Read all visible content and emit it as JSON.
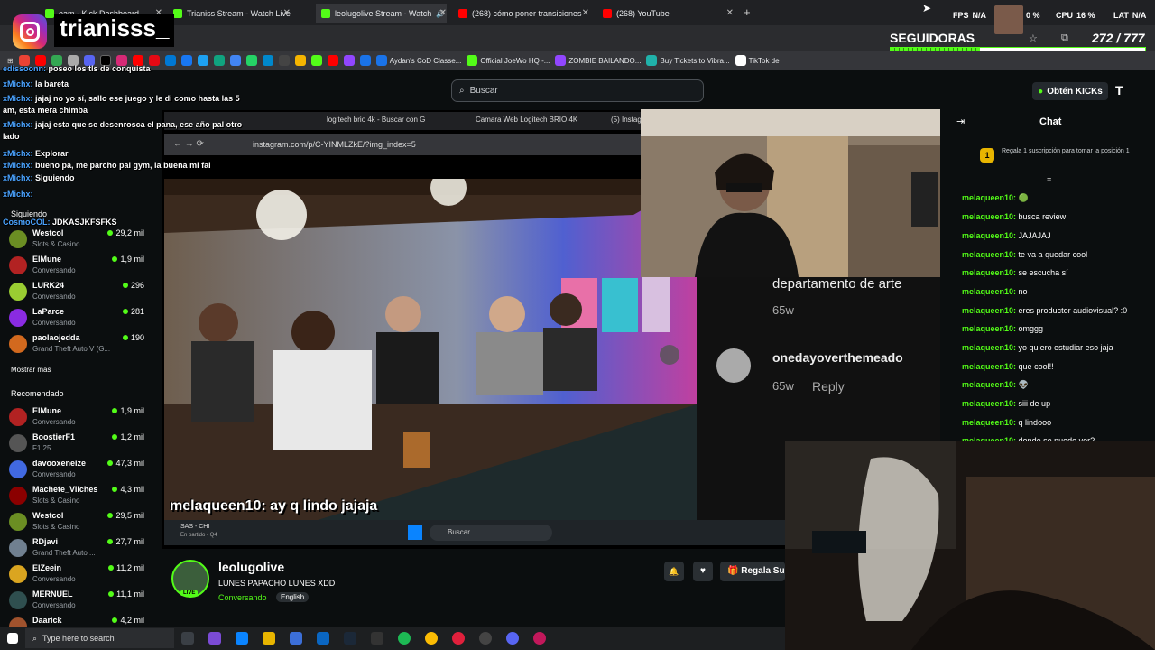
{
  "overlay": {
    "instagram_handle": "trianisss_",
    "followers_label": "SEGUIDORAS",
    "followers_value": "272 / 777",
    "fps_label": "FPS",
    "fps_value": "N/A",
    "cpu_label": "CPU",
    "cpu_value": "16 %",
    "lat_label": "LAT",
    "lat_value": "N/A",
    "zero_pct": "0 %"
  },
  "browser": {
    "tabs": [
      {
        "title": "eam - Kick Dashboard",
        "color": "#53fc18"
      },
      {
        "title": "Trianiss Stream - Watch Live on",
        "color": "#53fc18"
      },
      {
        "title": "leolugolive Stream - Watch",
        "color": "#53fc18"
      },
      {
        "title": "(268) cómo poner transiciones",
        "color": "#ff0000"
      },
      {
        "title": "(268) YouTube",
        "color": "#ff0000"
      }
    ],
    "bookmarks": [
      {
        "label": "Aydan's CoD Classe...",
        "color": "#1a73e8"
      },
      {
        "label": "Official JoeWo HQ -...",
        "color": "#53fc18"
      },
      {
        "label": "ZOMBIE BAILANDO...",
        "color": "#9146ff"
      },
      {
        "label": "Buy Tickets to Vibra...",
        "color": "#20b2aa"
      },
      {
        "label": "TikTok de",
        "color": "#ffffff"
      }
    ]
  },
  "kick": {
    "search_placeholder": "Buscar",
    "get_kicks": "Obtén KICKs",
    "sidebar_following": "Siguiendo",
    "sidebar_more": "Mostrar más",
    "sidebar_recommended": "Recomendado",
    "following": [
      {
        "name": "Westcol",
        "sub": "Slots & Casino",
        "viewers": "29,2 mil",
        "color": "#6b8e23"
      },
      {
        "name": "ElMune",
        "sub": "Conversando",
        "viewers": "1,9 mil",
        "color": "#b22222"
      },
      {
        "name": "LURK24",
        "sub": "Conversando",
        "viewers": "296",
        "color": "#9acd32"
      },
      {
        "name": "LaParce",
        "sub": "Conversando",
        "viewers": "281",
        "color": "#8a2be2"
      },
      {
        "name": "paolaojedda",
        "sub": "Grand Theft Auto V (G...",
        "viewers": "190",
        "color": "#d2691e"
      }
    ],
    "recommended": [
      {
        "name": "ElMune",
        "sub": "Conversando",
        "viewers": "1,9 mil",
        "color": "#b22222"
      },
      {
        "name": "BoostierF1",
        "sub": "F1 25",
        "viewers": "1,2 mil",
        "color": "#555555"
      },
      {
        "name": "davooxeneize",
        "sub": "Conversando",
        "viewers": "47,3 mil",
        "color": "#4169e1"
      },
      {
        "name": "Machete_Vilches",
        "sub": "Slots & Casino",
        "viewers": "4,3 mil",
        "color": "#8b0000"
      },
      {
        "name": "Westcol",
        "sub": "Slots & Casino",
        "viewers": "29,5 mil",
        "color": "#6b8e23"
      },
      {
        "name": "RDjavi",
        "sub": "Grand Theft Auto ...",
        "viewers": "27,7 mil",
        "color": "#708090"
      },
      {
        "name": "ElZeein",
        "sub": "Conversando",
        "viewers": "11,2 mil",
        "color": "#daa520"
      },
      {
        "name": "MERNUEL",
        "sub": "Conversando",
        "viewers": "11,1 mil",
        "color": "#2f4f4f"
      },
      {
        "name": "Daarick",
        "sub": "",
        "viewers": "4,2 mil",
        "color": "#a0522d"
      }
    ],
    "streamer": {
      "name": "leolugolive",
      "title": "LUNES PAPACHO LUNES XDD",
      "category": "Conversando",
      "language": "English",
      "live_badge": "LIVE",
      "subscribe_label": "Regala Su"
    },
    "chat": {
      "title": "Chat",
      "gift_text": "Regala 1 suscripción para tomar la posición 1",
      "gift_rank": "1",
      "messages": [
        {
          "user": "melaqueen10:",
          "text": "🟢"
        },
        {
          "user": "melaqueen10:",
          "text": "busca review"
        },
        {
          "user": "melaqueen10:",
          "text": "JAJAJAJ"
        },
        {
          "user": "melaqueen10:",
          "text": "te va a quedar cool"
        },
        {
          "user": "melaqueen10:",
          "text": "se escucha sí"
        },
        {
          "user": "melaqueen10:",
          "text": "no"
        },
        {
          "user": "melaqueen10:",
          "text": "eres productor audiovisual? :0"
        },
        {
          "user": "melaqueen10:",
          "text": "omggg"
        },
        {
          "user": "melaqueen10:",
          "text": "yo quiero estudiar eso jaja"
        },
        {
          "user": "melaqueen10:",
          "text": "que cool!!"
        },
        {
          "user": "melaqueen10:",
          "text": "👽"
        },
        {
          "user": "melaqueen10:",
          "text": "siii de up"
        },
        {
          "user": "melaqueen10:",
          "text": "q lindooo"
        },
        {
          "user": "melaqueen10:",
          "text": "donde se puede ver?"
        }
      ]
    }
  },
  "inner_stream": {
    "tabs": [
      "logitech brio 4k - Buscar con G",
      "Camara Web Logitech BRIO 4K",
      "(5) Instagr"
    ],
    "url": "instagram.com/p/C-YINMLZkE/?img_index=5",
    "caption": "melaqueen10: ay q lindo jajaja",
    "ig_comment_1": "departamento de arte",
    "ig_time_1": "65w",
    "ig_user_2": "onedayoverthemeado",
    "ig_time_2": "65w",
    "ig_reply": "Reply",
    "task_search": "Buscar",
    "sas_label": "SAS - CHI",
    "sas_sub": "En partido - Q4"
  },
  "overlay_chat": [
    {
      "user": "edissoonn:",
      "text": "poseo los tls de conquista"
    },
    {
      "user": "xMichx:",
      "text": "la bareta"
    },
    {
      "user": "xMichx:",
      "text": "jajaj no yo sí, sallo ese juego y le di como hasta las 5"
    },
    {
      "user": "",
      "text": "am, esta mera chimba"
    },
    {
      "user": "xMichx:",
      "text": "jajaj esta que se desenrosca el pana, ese año pal otro"
    },
    {
      "user": "",
      "text": "lado"
    },
    {
      "user": "xMichx:",
      "text": "Explorar"
    },
    {
      "user": "xMichx:",
      "text": "bueno pa, me parcho pal gym, la buena mi fai"
    },
    {
      "user": "xMichx:",
      "text": "Siguiendo"
    },
    {
      "user": "xMichx:",
      "text": ""
    },
    {
      "user": "CosmoCOL:",
      "text": "JDKASJKFSFKS"
    }
  ],
  "windows": {
    "search": "Type here to search"
  }
}
